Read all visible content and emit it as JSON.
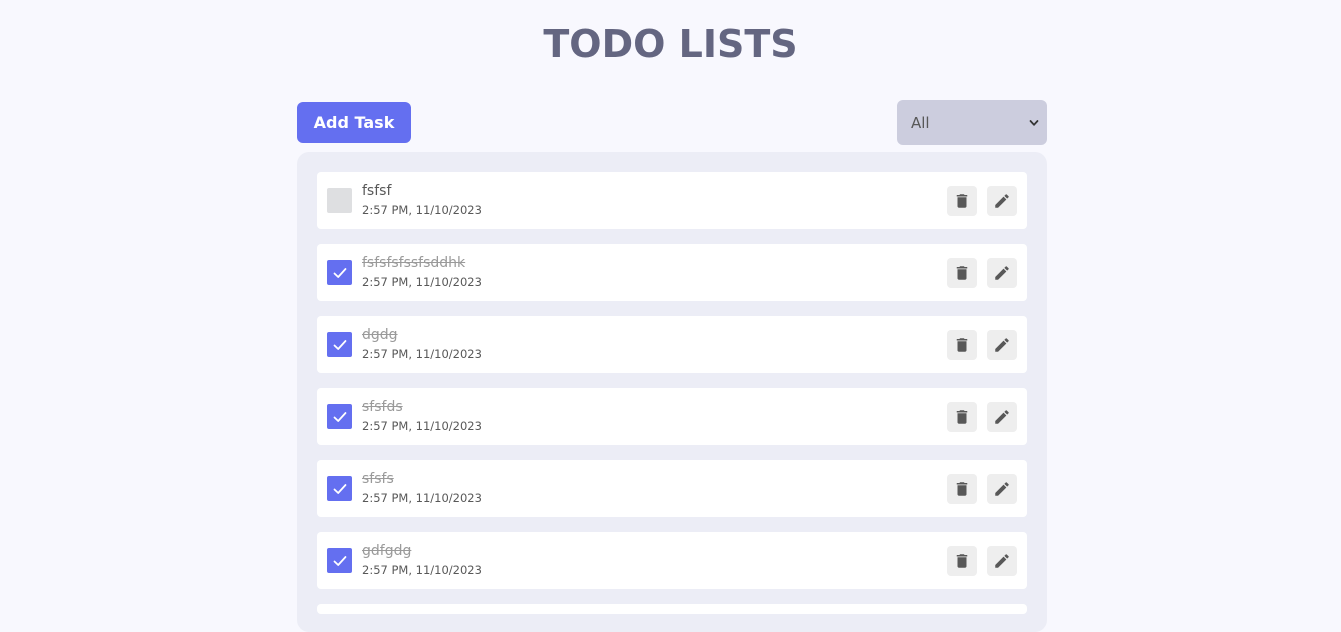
{
  "header": {
    "title": "TODO LISTS"
  },
  "toolbar": {
    "add_label": "Add Task",
    "filter_selected": "All"
  },
  "colors": {
    "accent": "#646ff0",
    "title": "#646681",
    "panel": "#ecedf6",
    "background": "#f8f8fe"
  },
  "todos": [
    {
      "text": "fsfsf",
      "time": "2:57 PM, 11/10/2023",
      "completed": false
    },
    {
      "text": "fsfsfsfssfsddhk",
      "time": "2:57 PM, 11/10/2023",
      "completed": true
    },
    {
      "text": "dgdg",
      "time": "2:57 PM, 11/10/2023",
      "completed": true
    },
    {
      "text": "sfsfds",
      "time": "2:57 PM, 11/10/2023",
      "completed": true
    },
    {
      "text": "sfsfs",
      "time": "2:57 PM, 11/10/2023",
      "completed": true
    },
    {
      "text": "gdfgdg",
      "time": "2:57 PM, 11/10/2023",
      "completed": true
    }
  ],
  "icons": {
    "delete": "trash-icon",
    "edit": "pencil-icon",
    "check": "checkmark-icon",
    "dropdown": "chevron-down-icon"
  }
}
